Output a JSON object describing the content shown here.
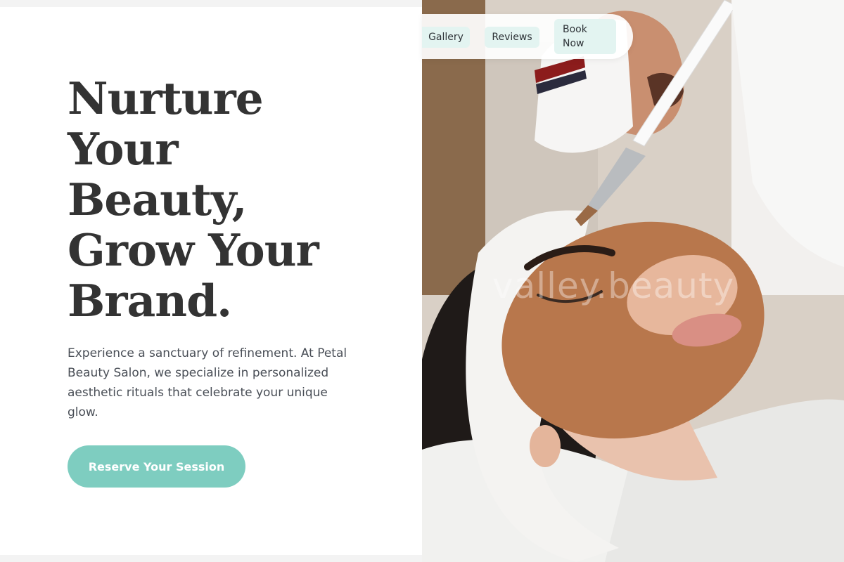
{
  "hero": {
    "title_lines": [
      "Nurture",
      "Your",
      "Beauty,",
      "Grow Your",
      "Brand."
    ],
    "description": "Experience a sanctuary of refinement. At Petal Beauty Salon, we specialize in personalized aesthetic rituals that celebrate your unique glow.",
    "cta_label": "Reserve Your Session"
  },
  "nav": {
    "items": [
      {
        "label": "Gallery"
      },
      {
        "label": "Reviews"
      },
      {
        "label": "Book\nNow"
      }
    ]
  },
  "photo": {
    "watermark": "valley.beauty"
  },
  "colors": {
    "accent": "#7ecdc0",
    "nav_pill": "#e3f4f1",
    "heading": "#333333",
    "body_text": "#4a4f57"
  }
}
